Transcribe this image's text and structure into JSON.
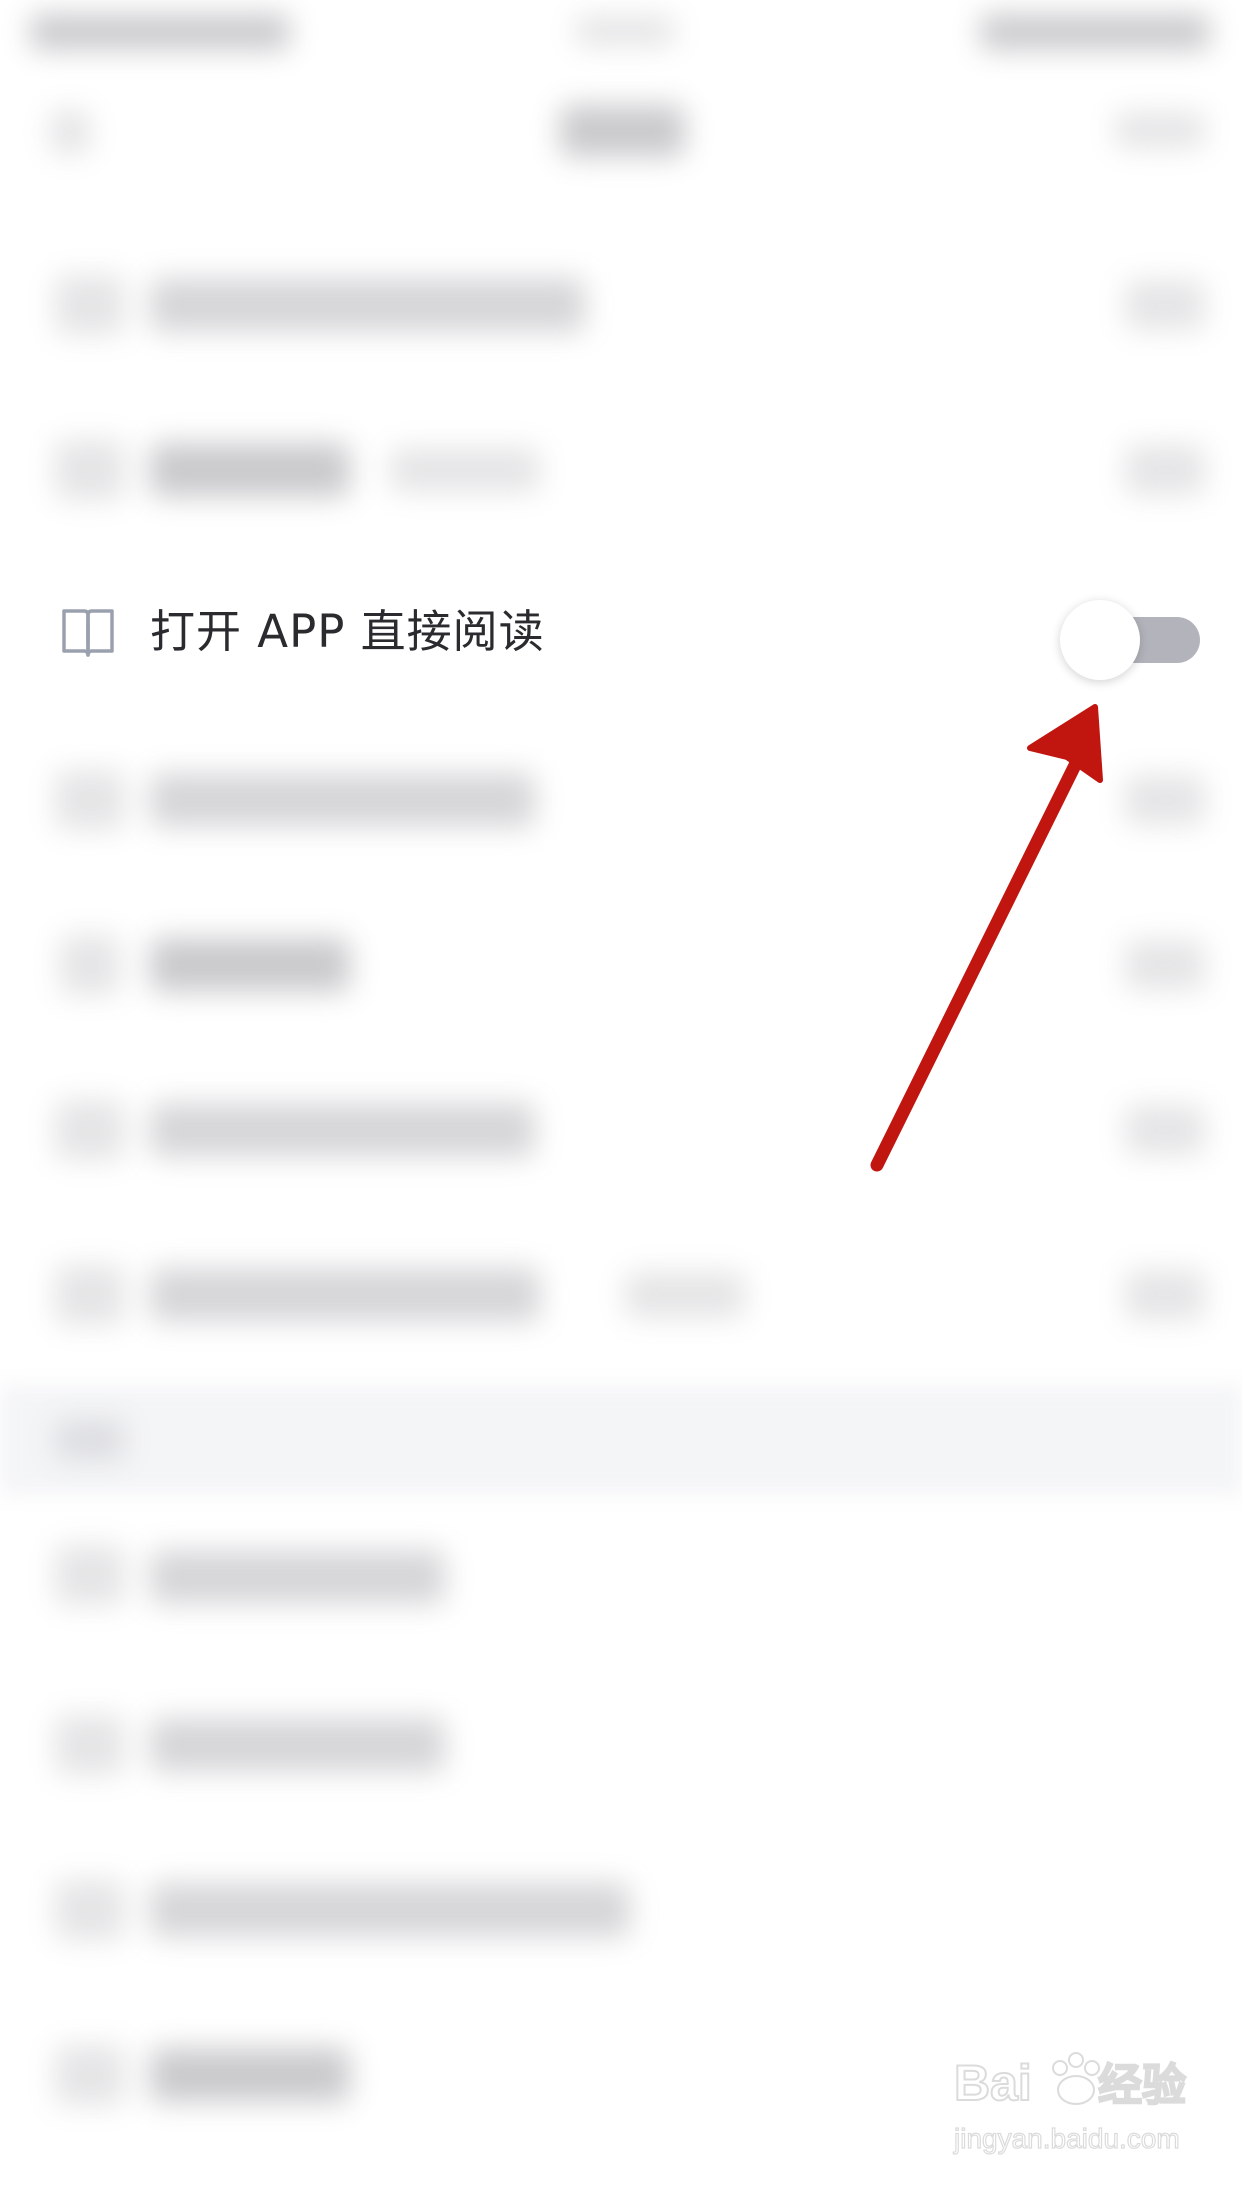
{
  "setting": {
    "label": "打开 APP 直接阅读",
    "icon": "book-icon",
    "toggle_on": false
  },
  "annotation": {
    "color": "#c0160f"
  },
  "watermark": {
    "logo": "Baidu经验",
    "url": "jingyan.baidu.com"
  },
  "colors": {
    "toggle_track": "#b3b3bb",
    "label_text": "#2a2a2f"
  }
}
